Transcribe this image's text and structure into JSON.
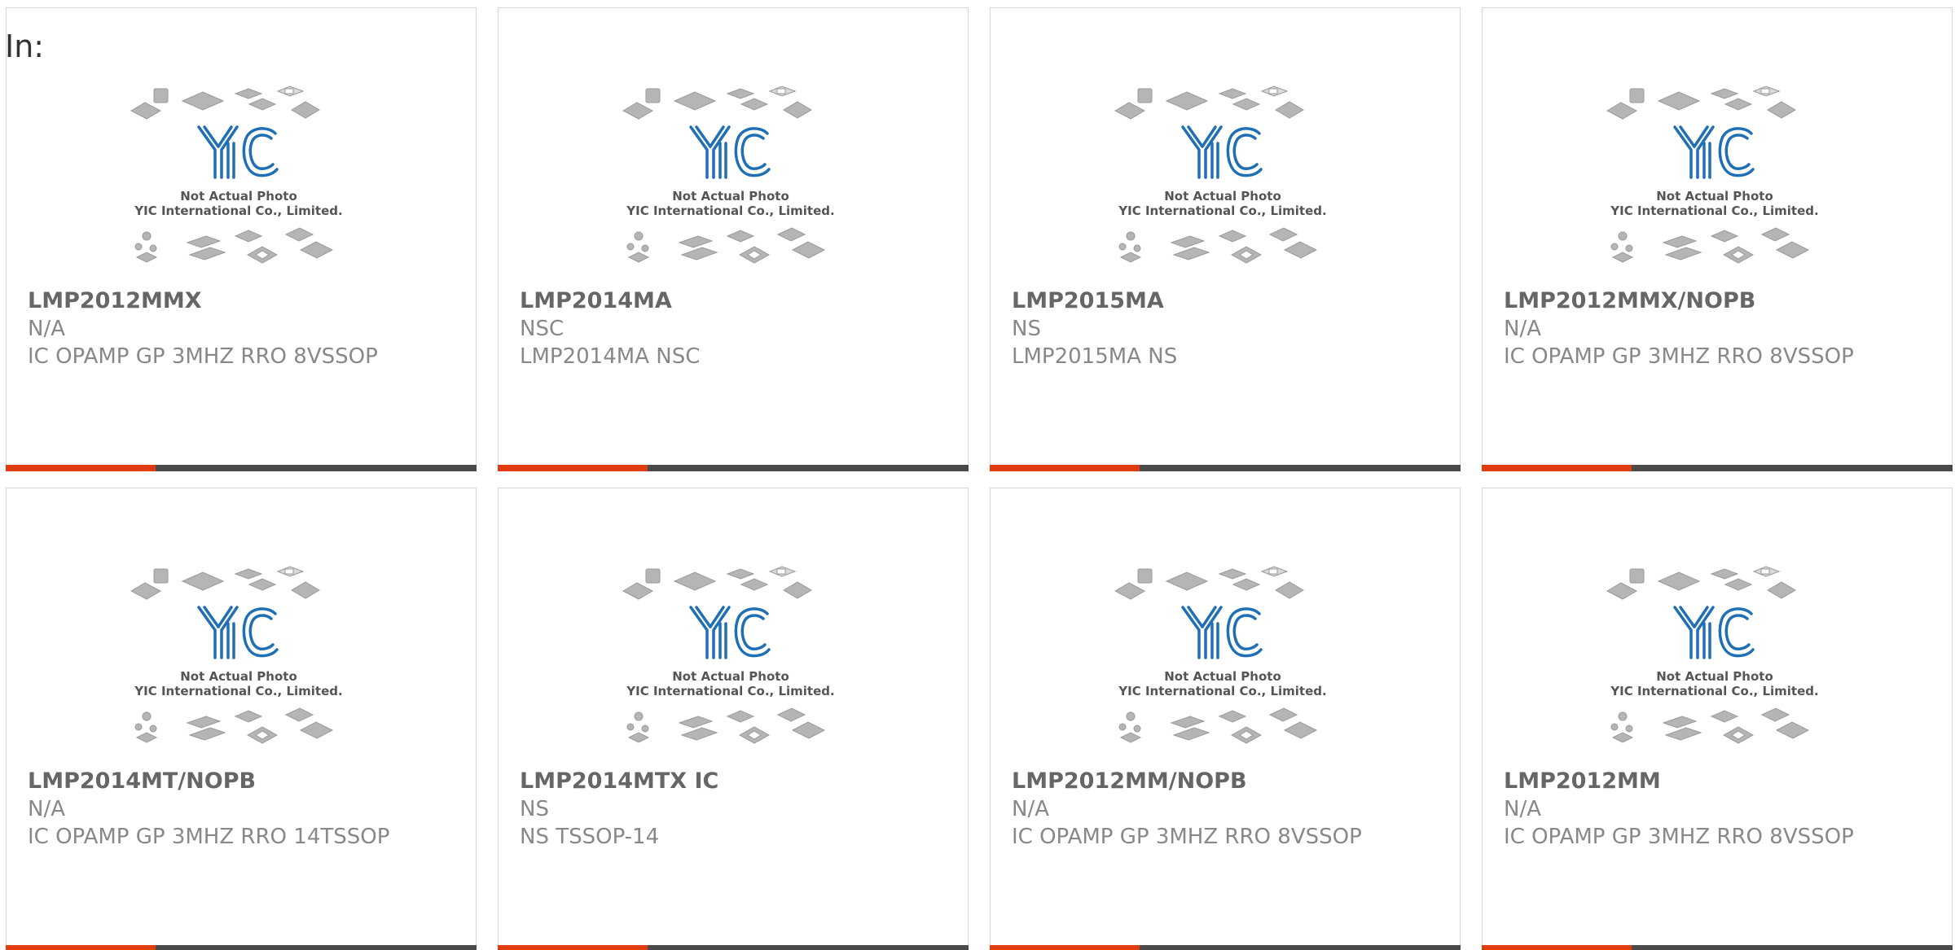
{
  "header": {
    "label": "In:"
  },
  "placeholder": {
    "line1": "Not Actual Photo",
    "line2": "YIC International Co., Limited.",
    "logo": "YIC"
  },
  "colors": {
    "accent": "#e03c10",
    "bar": "#4a4a4a",
    "logo_blue": "#1f6fb5"
  },
  "products": [
    {
      "part": "LMP2012MMX",
      "manufacturer": "N/A",
      "description": "IC OPAMP GP 3MHZ RRO 8VSSOP"
    },
    {
      "part": "LMP2014MA",
      "manufacturer": "NSC",
      "description": "LMP2014MA NSC"
    },
    {
      "part": "LMP2015MA",
      "manufacturer": "NS",
      "description": "LMP2015MA NS"
    },
    {
      "part": "LMP2012MMX/NOPB",
      "manufacturer": "N/A",
      "description": "IC OPAMP GP 3MHZ RRO 8VSSOP"
    },
    {
      "part": "LMP2014MT/NOPB",
      "manufacturer": "N/A",
      "description": "IC OPAMP GP 3MHZ RRO 14TSSOP"
    },
    {
      "part": "LMP2014MTX IC",
      "manufacturer": "NS",
      "description": "NS TSSOP-14"
    },
    {
      "part": "LMP2012MM/NOPB",
      "manufacturer": "N/A",
      "description": "IC OPAMP GP 3MHZ RRO 8VSSOP"
    },
    {
      "part": "LMP2012MM",
      "manufacturer": "N/A",
      "description": "IC OPAMP GP 3MHZ RRO 8VSSOP"
    }
  ]
}
